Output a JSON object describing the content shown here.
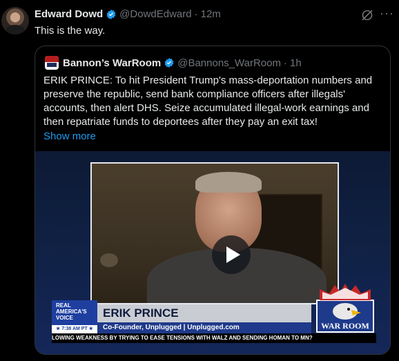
{
  "tweet": {
    "author_name": "Edward Dowd",
    "handle": "@DowdEdward",
    "separator": "·",
    "time": "12m",
    "text": "This is the way.",
    "verified_icon": "verified-badge-icon",
    "grok_icon": "grok-icon",
    "more_icon": "more-icon"
  },
  "quote": {
    "author_name": "Bannon’s WarRoom",
    "handle": "@Bannons_WarRoom",
    "separator": "·",
    "time": "1h",
    "lines": [
      "ERIK PRINCE: To hit President Trump's mass-deportation numbers and",
      "preserve the republic, send bank compliance officers after illegals'",
      "accounts, then alert DHS. Seize accumulated illegal-work earnings and",
      "then repatriate funds to deportees after they pay an exit tax!"
    ],
    "show_more": "Show more"
  },
  "video": {
    "network_line1": "REAL",
    "network_line2": "AMERICA'S",
    "network_line3": "VOICE",
    "time_label": "★ 7:38 AM PT ★",
    "guest_name": "ERIK PRINCE",
    "guest_subtitle": "Co-Founder, Unplugged | Unplugged.com",
    "show_logo_text": "WAR ROOM",
    "ticker": "LOWING WEAKNESS BY TRYING TO EASE TENSIONS WITH WALZ AND SENDING HOMAN TO MN?",
    "play_icon": "play-icon"
  },
  "colors": {
    "link": "#1d9bf0",
    "muted": "#71767b",
    "verified": "#1d9bf0"
  }
}
